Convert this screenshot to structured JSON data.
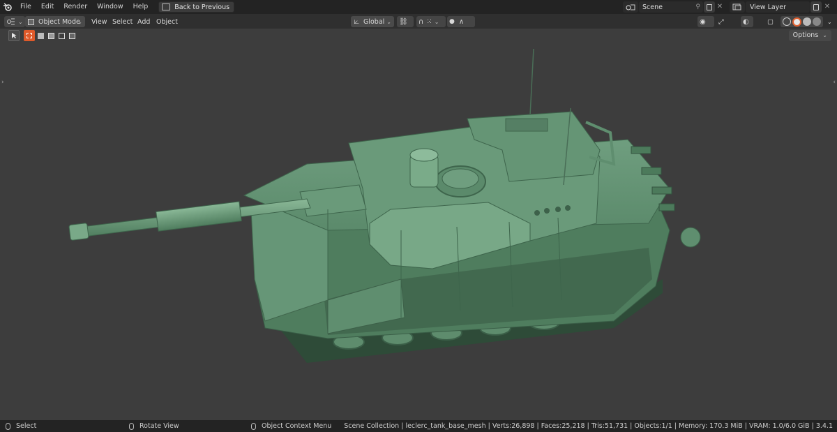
{
  "menu": {
    "items": [
      "File",
      "Edit",
      "Render",
      "Window",
      "Help"
    ],
    "back_label": "Back to Previous"
  },
  "topright": {
    "scene_label": "Scene",
    "view_layer_label": "View Layer"
  },
  "header": {
    "mode_label": "Object Mode",
    "menus": [
      "View",
      "Select",
      "Add",
      "Object"
    ],
    "orientation_label": "Global"
  },
  "toolbar": {
    "options_label": "Options"
  },
  "status": {
    "select_label": "Select",
    "rotate_label": "Rotate View",
    "context_label": "Object Context Menu",
    "info": "Scene Collection | leclerc_tank_base_mesh | Verts:26,898 | Faces:25,218 | Tris:51,731 | Objects:1/1 | Memory: 170.3 MiB | VRAM: 1.0/6.0 GiB | 3.4.1"
  },
  "colors": {
    "tank_base": "#5b8a6b",
    "tank_light": "#7fae8e",
    "tank_dark": "#3e654c",
    "selection_accent": "#e05a2a",
    "viewport_bg": "#3d3d3d"
  },
  "icons": {
    "logo": "blender-logo-icon",
    "editor_type": "3d-viewport-icon",
    "select_box": "select-box-icon"
  }
}
